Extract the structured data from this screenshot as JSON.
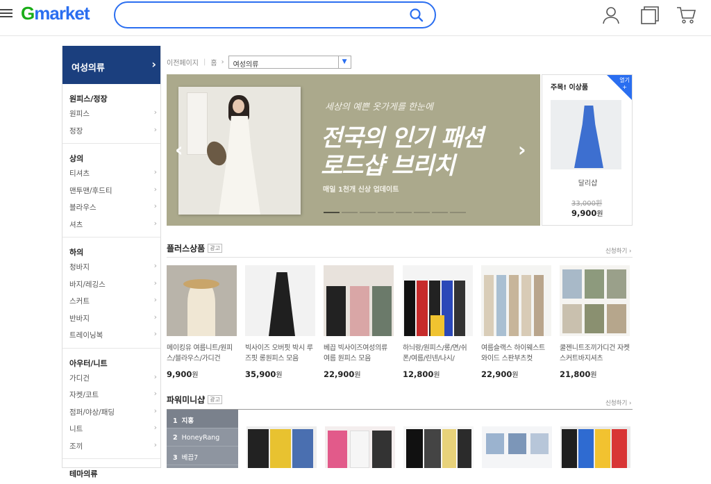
{
  "header": {
    "logo": "Gmarket",
    "search_placeholder": "",
    "colors": {
      "brand_green": "#1aad19",
      "brand_blue": "#2a6ef0"
    }
  },
  "sidebar": {
    "heading": "여성의류",
    "groups": [
      {
        "title": "원피스/정장",
        "items": [
          "원피스",
          "정장"
        ]
      },
      {
        "title": "상의",
        "items": [
          "티셔츠",
          "맨투맨/후드티",
          "블라우스",
          "셔츠"
        ]
      },
      {
        "title": "하의",
        "items": [
          "청바지",
          "바지/레깅스",
          "스커트",
          "반바지",
          "트레이닝복"
        ]
      },
      {
        "title": "아우터/니트",
        "items": [
          "가디건",
          "자켓/코트",
          "점퍼/야상/패딩",
          "니트",
          "조끼"
        ]
      },
      {
        "title": "테마의류",
        "items": []
      }
    ]
  },
  "breadcrumb": {
    "prev": "이전페이지",
    "home": "홈",
    "selected": "여성의류"
  },
  "banner": {
    "subtitle": "세상의 예쁜 옷가게를 한눈에",
    "headline_1": "전국의 인기 패션",
    "headline_2": "로드샵 브리치",
    "note": "매일 1천개 신상 업데이트",
    "slide_count": 8,
    "active_slide": 1
  },
  "promo": {
    "title": "주목! 이상품",
    "corner": "열기",
    "name": "달리샵",
    "original_price": "33,000원",
    "price": "9,900",
    "unit": "원"
  },
  "plus": {
    "title": "플러스상품",
    "ad": "광고",
    "link": "신청하기",
    "products": [
      {
        "title": "메이킹유 여름니트/원피스/블라우스/가디건",
        "price": "9,900",
        "unit": "원"
      },
      {
        "title": "빅사이즈 오버핏 박시 루즈핏 롱원피스 모음",
        "price": "35,900",
        "unit": "원"
      },
      {
        "title": "베끕 빅사이즈여성의류 여름 원피스 모음",
        "price": "22,900",
        "unit": "원"
      },
      {
        "title": "하늬랑/원피스/롱/면/쉬폰/여름/린넨/나시/",
        "price": "12,800",
        "unit": "원"
      },
      {
        "title": "여름슬랙스 하이웨스트 와이드 스판부츠컷",
        "price": "22,900",
        "unit": "원"
      },
      {
        "title": "쿨젠니트조끼가디건 자켓스커트바지셔츠",
        "price": "21,800",
        "unit": "원"
      }
    ]
  },
  "power": {
    "title": "파워미니샵",
    "ad": "광고",
    "link": "신청하기",
    "ranks": [
      {
        "no": "1",
        "name": "지홍"
      },
      {
        "no": "2",
        "name": "HoneyRang"
      },
      {
        "no": "3",
        "name": "베끕7"
      }
    ]
  }
}
